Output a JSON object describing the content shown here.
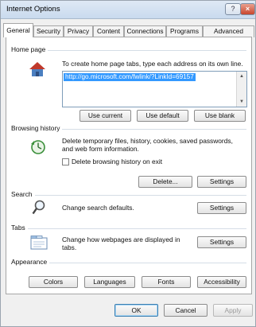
{
  "window": {
    "title": "Internet Options",
    "help_glyph": "?",
    "close_glyph": "×"
  },
  "tabs": [
    {
      "label": "General",
      "active": true
    },
    {
      "label": "Security"
    },
    {
      "label": "Privacy"
    },
    {
      "label": "Content"
    },
    {
      "label": "Connections"
    },
    {
      "label": "Programs"
    },
    {
      "label": "Advanced"
    }
  ],
  "home_page": {
    "label": "Home page",
    "description": "To create home page tabs, type each address on its own line.",
    "url": "http://go.microsoft.com/fwlink/?LinkId=69157",
    "use_current": "Use current",
    "use_default": "Use default",
    "use_blank": "Use blank",
    "icon": "house-icon"
  },
  "browsing_history": {
    "label": "Browsing history",
    "description_line1": "Delete temporary files, history, cookies, saved passwords,",
    "description_line2": "and web form information.",
    "checkbox_label": "Delete browsing history on exit",
    "checked": false,
    "delete_button": "Delete...",
    "settings_button": "Settings",
    "icon": "history-icon"
  },
  "search": {
    "label": "Search",
    "description": "Change search defaults.",
    "settings_button": "Settings",
    "icon": "magnifier-icon"
  },
  "tabs_section": {
    "label": "Tabs",
    "description_line1": "Change how webpages are displayed in",
    "description_line2": "tabs.",
    "settings_button": "Settings",
    "icon": "tabs-window-icon"
  },
  "appearance": {
    "label": "Appearance",
    "colors": "Colors",
    "languages": "Languages",
    "fonts": "Fonts",
    "accessibility": "Accessibility"
  },
  "footer": {
    "ok": "OK",
    "cancel": "Cancel",
    "apply": "Apply"
  }
}
